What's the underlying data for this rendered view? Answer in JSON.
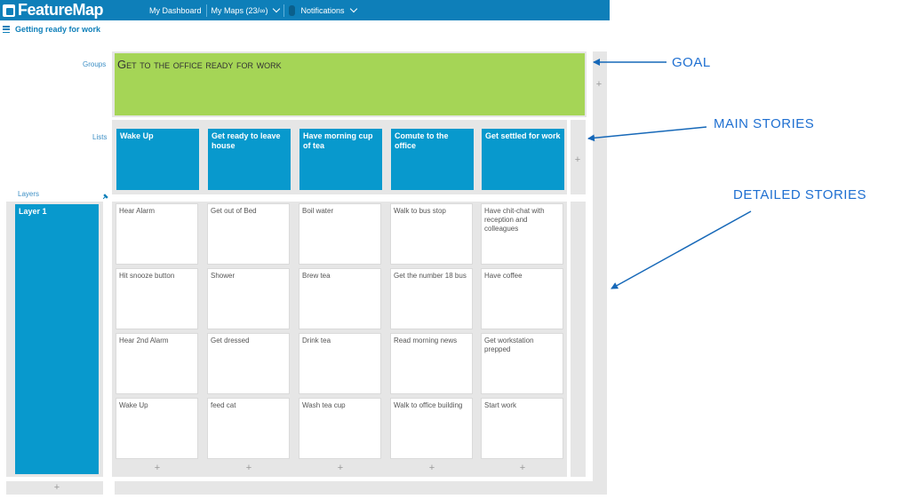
{
  "app": {
    "name": "FeatureMap"
  },
  "nav": {
    "dashboard": "My Dashboard",
    "maps": "My Maps (23/∞)",
    "notifications_count": "0",
    "notifications": "Notifications"
  },
  "map": {
    "title": "Getting ready for work"
  },
  "row_labels": {
    "groups": "Groups",
    "lists": "Lists",
    "layers": "Layers"
  },
  "goal": "Get to the office ready for work",
  "lists": [
    "Wake Up",
    "Get ready to leave house",
    "Have morning cup of tea",
    "Comute to the office",
    "Get settled for work"
  ],
  "layer": "Layer 1",
  "stories": [
    [
      "Hear Alarm",
      "Hit snooze button",
      "Hear 2nd Alarm",
      "Wake Up"
    ],
    [
      "Get out of Bed",
      "Shower",
      "Get dressed",
      "feed cat"
    ],
    [
      "Boil water",
      "Brew tea",
      "Drink tea",
      "Wash tea cup"
    ],
    [
      "Walk to bus stop",
      "Get the number 18 bus",
      "Read morning news",
      "Walk to office building"
    ],
    [
      "Have chit-chat with reception and colleagues",
      "Have coffee",
      "Get workstation prepped",
      "Start work"
    ]
  ],
  "plus_symbol": "+",
  "annotations": {
    "goal": "GOAL",
    "main": "MAIN STORIES",
    "detailed": "DETAILED STORIES"
  },
  "colors": {
    "brand": "#0e7fb9",
    "card": "#0899cd",
    "goal": "#a5d556",
    "annotation": "#1e6fd1"
  }
}
